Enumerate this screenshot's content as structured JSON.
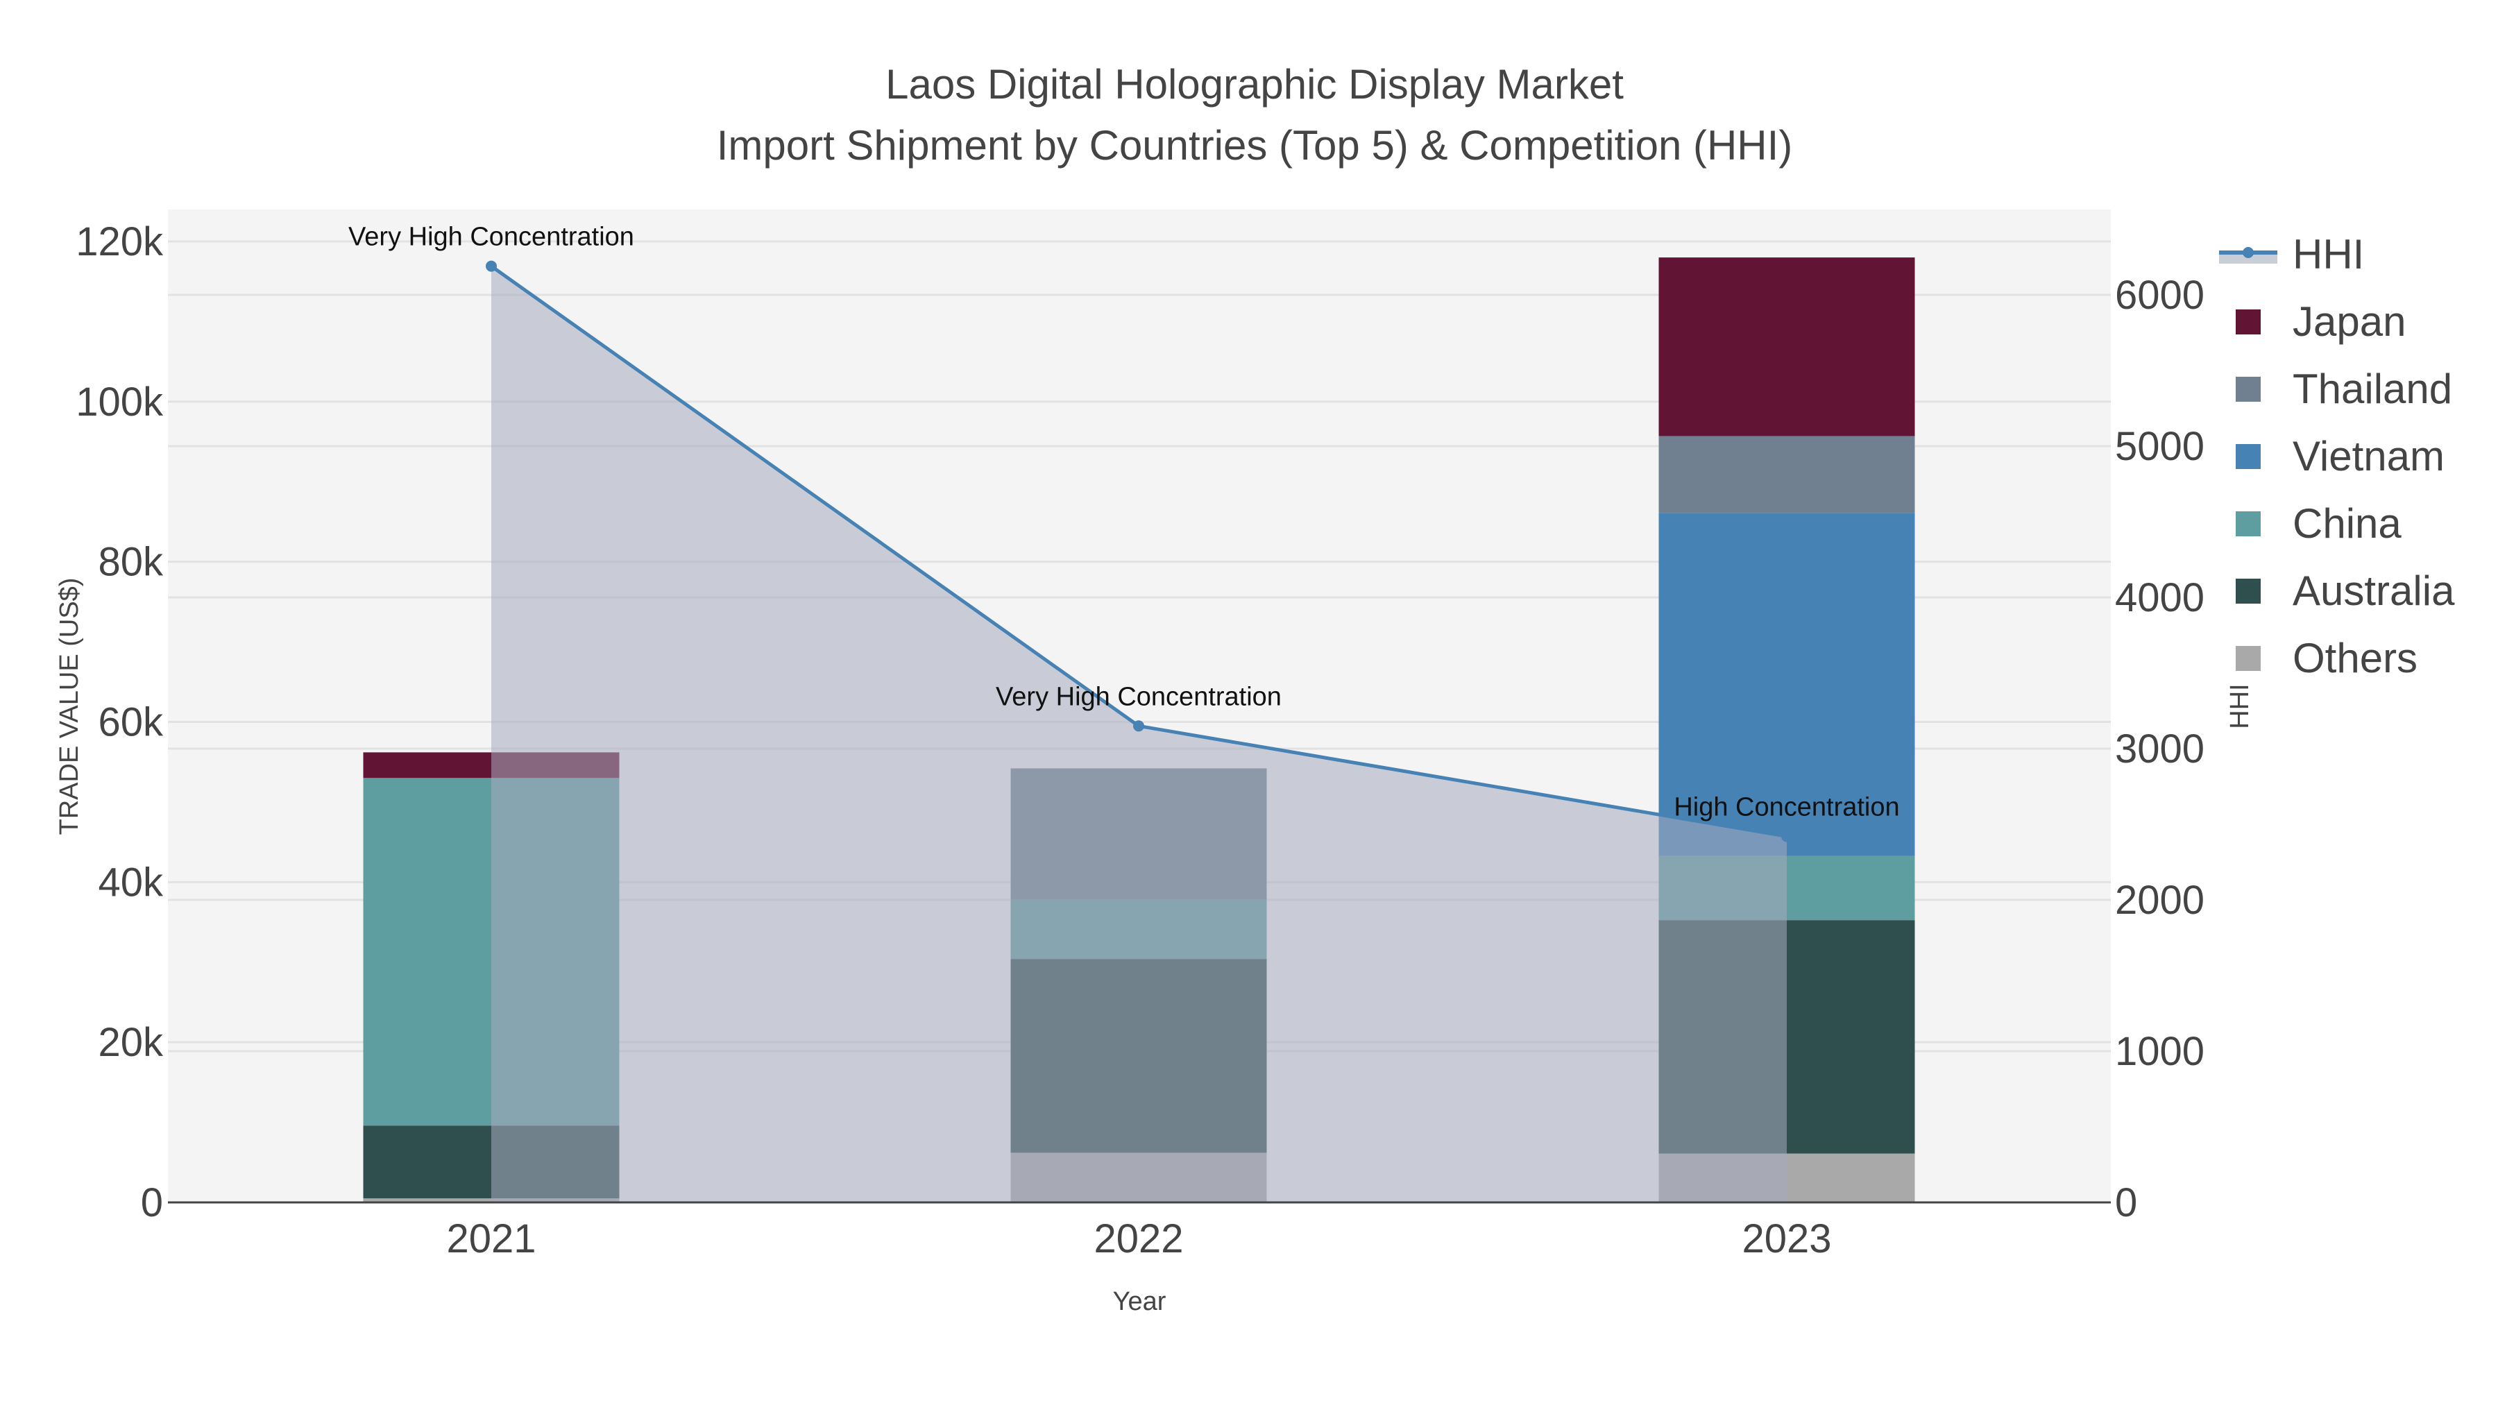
{
  "chart_data": {
    "type": "bar",
    "barmode": "stack",
    "title": "Laos Digital Holographic Display Market",
    "subtitle": "Import Shipment by Countries (Top 5) & Competition (HHI)",
    "xlabel": "Year",
    "ylabel": "TRADE VALUE (US$)",
    "y2label": "HHI",
    "categories": [
      "2021",
      "2022",
      "2023"
    ],
    "ylim": [
      0,
      124000
    ],
    "y2lim": [
      0,
      6600
    ],
    "yticks": [
      0,
      20000,
      40000,
      60000,
      80000,
      100000,
      120000
    ],
    "ytick_labels": [
      "0",
      "20k",
      "40k",
      "60k",
      "80k",
      "100k",
      "120k"
    ],
    "y2ticks": [
      0,
      1000,
      2000,
      3000,
      4000,
      5000,
      6000
    ],
    "y2tick_labels": [
      "0",
      "1000",
      "2000",
      "3000",
      "4000",
      "5000",
      "6000"
    ],
    "series": [
      {
        "name": "Others",
        "color": "#a9a9a9",
        "values": [
          500,
          6200,
          6100
        ]
      },
      {
        "name": "Australia",
        "color": "#2f4f4f",
        "values": [
          9100,
          24200,
          29150
        ]
      },
      {
        "name": "China",
        "color": "#5f9ea0",
        "values": [
          43400,
          7400,
          8000
        ]
      },
      {
        "name": "Vietnam",
        "color": "#4682b4",
        "values": [
          0,
          0,
          42850
        ]
      },
      {
        "name": "Thailand",
        "color": "#708090",
        "values": [
          0,
          16400,
          9600
        ]
      },
      {
        "name": "Japan",
        "color": "#611434",
        "values": [
          3200,
          0,
          22300
        ]
      }
    ],
    "legend_order": [
      "Japan",
      "Thailand",
      "Vietnam",
      "China",
      "Australia",
      "Others"
    ],
    "hhi": {
      "name": "HHI",
      "color": "#4682b4",
      "values": [
        6190,
        3150,
        2420
      ],
      "annotations": [
        "Very High Concentration",
        "Very High Concentration",
        "High Concentration"
      ]
    },
    "grid": true,
    "legend_position": "right"
  }
}
